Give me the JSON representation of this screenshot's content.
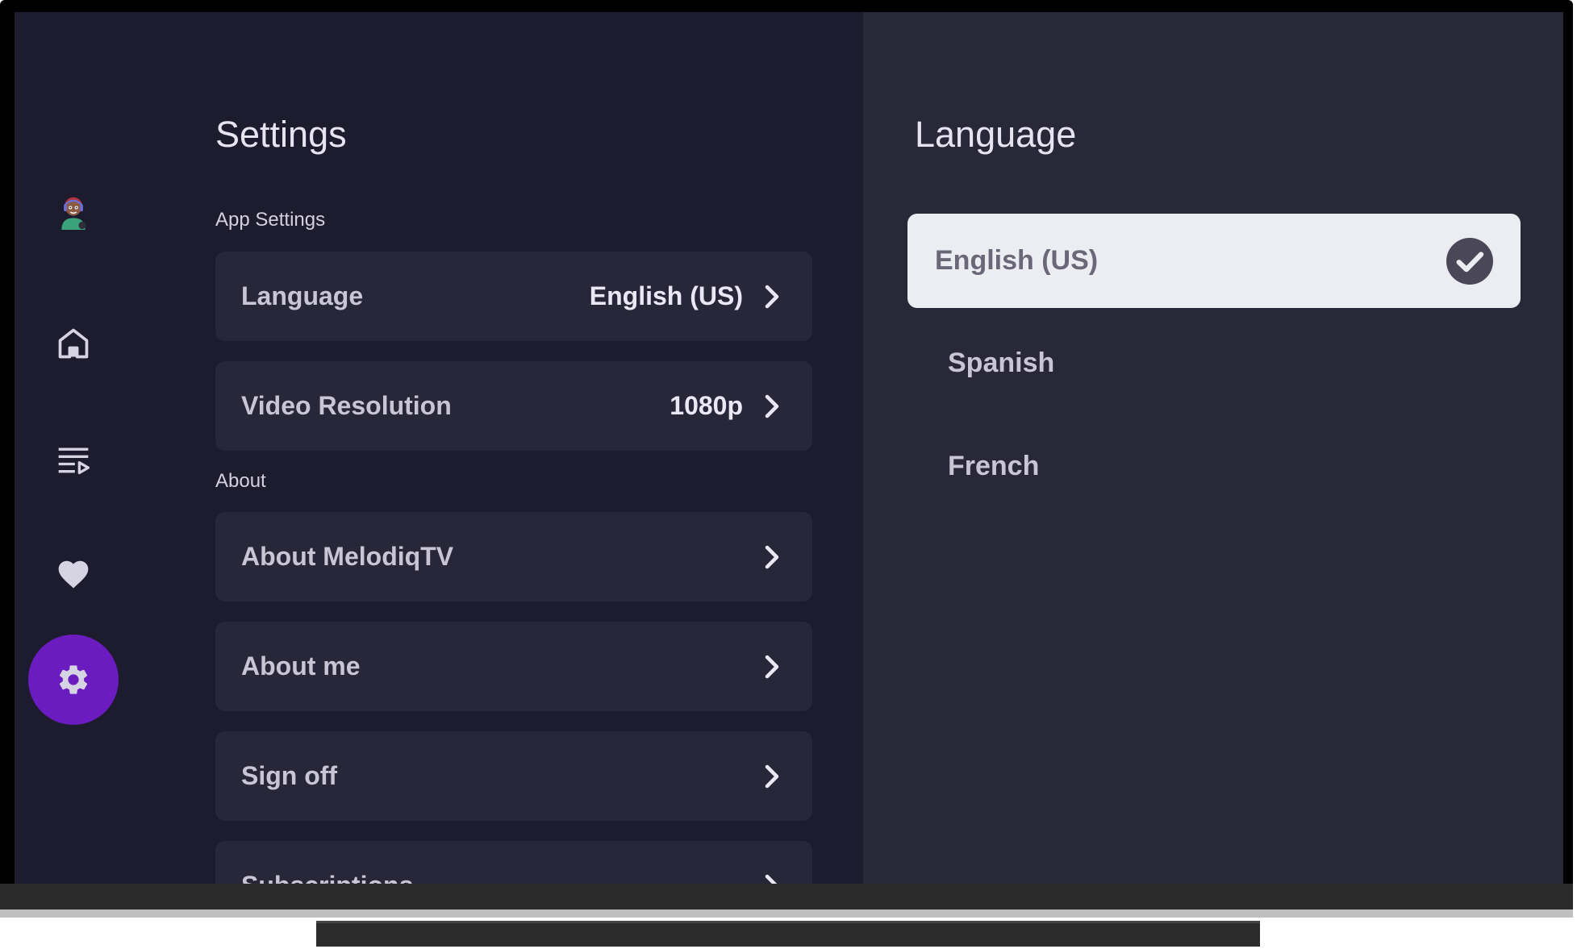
{
  "nav": {
    "items": [
      {
        "name": "profile",
        "icon": "avatar"
      },
      {
        "name": "home",
        "icon": "home-icon"
      },
      {
        "name": "playlist",
        "icon": "playlist-icon"
      },
      {
        "name": "favorites",
        "icon": "heart-icon"
      },
      {
        "name": "settings",
        "icon": "gear-icon",
        "active": true
      }
    ],
    "active_color": "#6a1cc1"
  },
  "settings": {
    "title": "Settings",
    "app_section_label": "App Settings",
    "about_section_label": "About",
    "rows": [
      {
        "label": "Language",
        "value": "English (US)"
      },
      {
        "label": "Video Resolution",
        "value": "1080p"
      },
      {
        "label": "About MelodiqTV",
        "value": ""
      },
      {
        "label": "About me",
        "value": ""
      },
      {
        "label": "Sign off",
        "value": ""
      },
      {
        "label": "Subscriptions",
        "value": ""
      }
    ]
  },
  "language_panel": {
    "title": "Language",
    "options": [
      {
        "label": "English (US)",
        "selected": true
      },
      {
        "label": "Spanish",
        "selected": false
      },
      {
        "label": "French",
        "selected": false
      }
    ]
  }
}
